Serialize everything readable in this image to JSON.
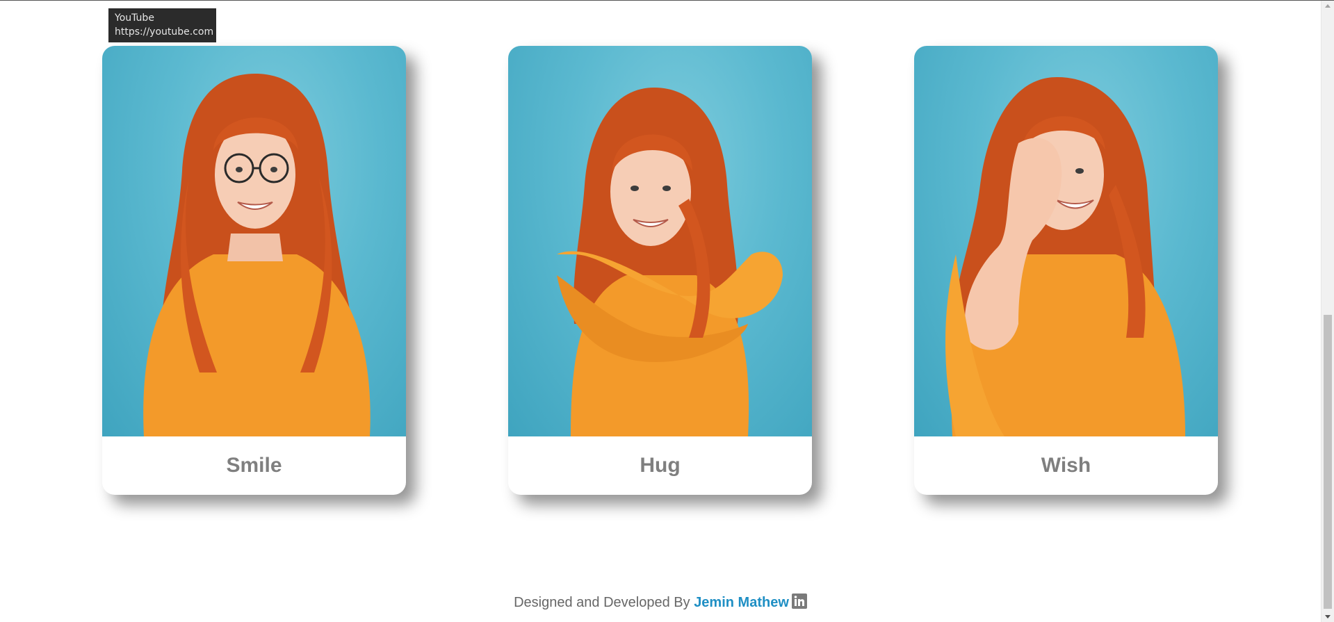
{
  "tooltip": {
    "title": "YouTube",
    "url": "https://youtube.com"
  },
  "cards": [
    {
      "label": "Smile",
      "icon": "smiling-woman-glasses-photo"
    },
    {
      "label": "Hug",
      "icon": "hugging-woman-photo"
    },
    {
      "label": "Wish",
      "icon": "laughing-woman-photo"
    }
  ],
  "footer": {
    "prefix": "Designed and Developed By",
    "author": "Jemin Mathew",
    "icon": "linkedin-icon"
  },
  "colors": {
    "photo_background": "#5bb9d0",
    "sweater": "#f39a2a",
    "hair": "#d2561f",
    "caption_text": "#7f7f7f",
    "author_link": "#1f8fc4"
  }
}
